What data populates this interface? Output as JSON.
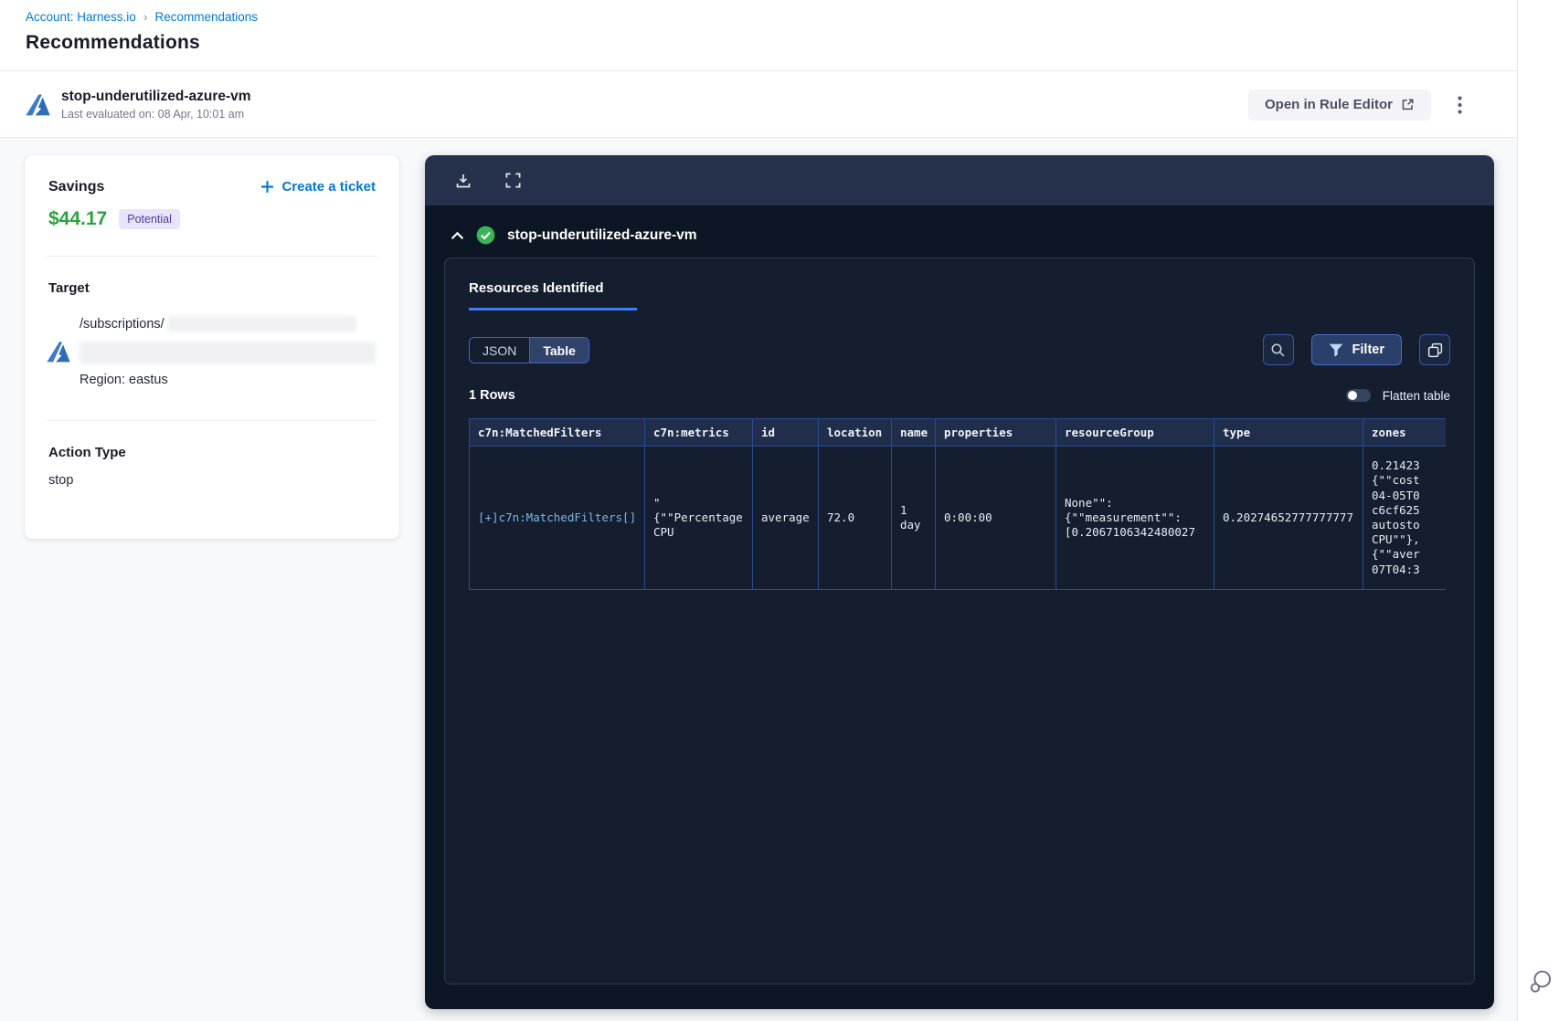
{
  "breadcrumb": {
    "items": [
      "Account: Harness.io",
      "Recommendations"
    ],
    "separator": "›"
  },
  "page": {
    "title": "Recommendations"
  },
  "recommendation": {
    "name": "stop-underutilized-azure-vm",
    "last_evaluated": "Last evaluated on: 08 Apr, 10:01 am",
    "open_in_rule_editor": "Open in Rule Editor"
  },
  "details": {
    "savings_label": "Savings",
    "savings_value": "$44.17",
    "savings_badge": "Potential",
    "create_ticket_label": "Create a ticket",
    "target_label": "Target",
    "target_path": "/subscriptions/",
    "region": "Region: eastus",
    "action_type_label": "Action Type",
    "action_type_value": "stop"
  },
  "resources_panel": {
    "title": "stop-underutilized-azure-vm",
    "tab_label": "Resources Identified",
    "view_toggle": {
      "json_label": "JSON",
      "table_label": "Table",
      "selected": "Table"
    },
    "filter_button_label": "Filter",
    "rows_count": "1 Rows",
    "flatten_table_label": "Flatten table",
    "flatten_table_on": false,
    "table": {
      "columns": [
        "c7n:MatchedFilters",
        "c7n:metrics",
        "id",
        "location",
        "name",
        "properties",
        "resourceGroup",
        "type",
        "zones"
      ],
      "row": {
        "c7n_matched_filters": "[+]c7n:MatchedFilters[]",
        "c7n_metrics": [
          "\"",
          "{\"\"Percentage",
          "CPU"
        ],
        "id": "average",
        "location": "72.0",
        "name": "1 day",
        "properties": "0:00:00",
        "resource_group": [
          "None\"\":",
          "{\"\"measurement\"\":",
          "[0.2067106342480027"
        ],
        "type": "0.20274652777777777",
        "zones": [
          "0.21423",
          "{\"\"cost",
          "04-05T0",
          "c6cf625",
          "autosto",
          "CPU\"\"},",
          "{\"\"aver",
          "07T04:3"
        ]
      }
    }
  },
  "colors": {
    "primary_blue": "#0278d5",
    "savings_green": "#2aa33c",
    "badge_purple_bg": "#e9e4fc",
    "badge_purple_text": "#4a3b9c",
    "panel_toolbar": "#26324b",
    "panel_body": "#0d1624",
    "panel_card": "#141e2f",
    "table_border_blue": "#2b4a92",
    "tab_underline_blue": "#3d7df5",
    "check_green": "#3cb557",
    "azure_blue": "#3b7bc8"
  }
}
